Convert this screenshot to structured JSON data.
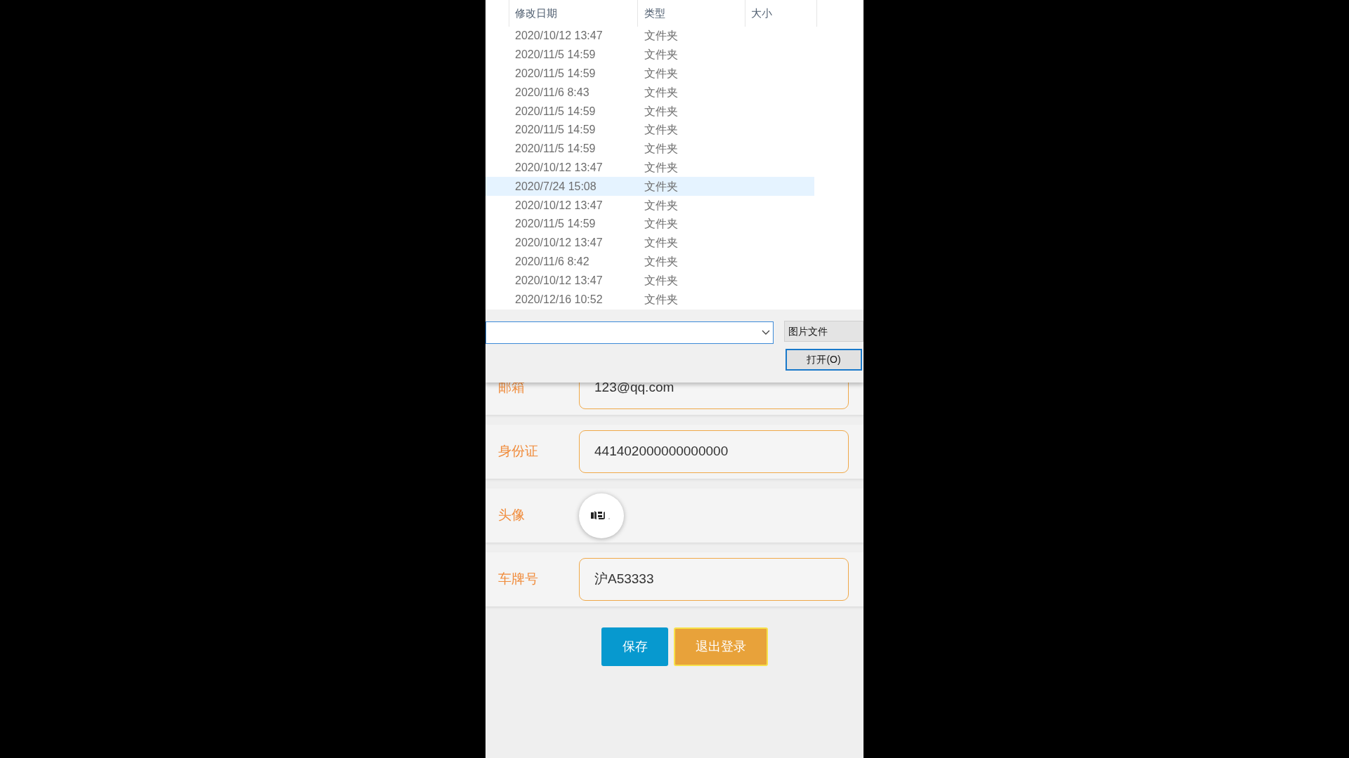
{
  "file_dialog": {
    "columns": [
      {
        "label": "修改日期"
      },
      {
        "label": "类型"
      },
      {
        "label": "大小"
      }
    ],
    "rows": [
      {
        "modified": "2020/10/12 13:47",
        "type": "文件夹",
        "selected": false
      },
      {
        "modified": "2020/11/5 14:59",
        "type": "文件夹",
        "selected": false
      },
      {
        "modified": "2020/11/5 14:59",
        "type": "文件夹",
        "selected": false
      },
      {
        "modified": "2020/11/6 8:43",
        "type": "文件夹",
        "selected": false
      },
      {
        "modified": "2020/11/5 14:59",
        "type": "文件夹",
        "selected": false
      },
      {
        "modified": "2020/11/5 14:59",
        "type": "文件夹",
        "selected": false
      },
      {
        "modified": "2020/11/5 14:59",
        "type": "文件夹",
        "selected": false
      },
      {
        "modified": "2020/10/12 13:47",
        "type": "文件夹",
        "selected": false
      },
      {
        "modified": "2020/7/24 15:08",
        "type": "文件夹",
        "selected": true
      },
      {
        "modified": "2020/10/12 13:47",
        "type": "文件夹",
        "selected": false
      },
      {
        "modified": "2020/11/5 14:59",
        "type": "文件夹",
        "selected": false
      },
      {
        "modified": "2020/10/12 13:47",
        "type": "文件夹",
        "selected": false
      },
      {
        "modified": "2020/11/6 8:42",
        "type": "文件夹",
        "selected": false
      },
      {
        "modified": "2020/10/12 13:47",
        "type": "文件夹",
        "selected": false
      },
      {
        "modified": "2020/12/16 10:52",
        "type": "文件夹",
        "selected": false
      }
    ],
    "file_type_filter": "图片文件",
    "open_button": "打开(O)"
  },
  "form": {
    "fields": [
      {
        "kind": "input",
        "label": "邮箱",
        "value": "123@qq.com"
      },
      {
        "kind": "input",
        "label": "身份证",
        "value": "441402000000000000"
      },
      {
        "kind": "avatar",
        "label": "头像"
      },
      {
        "kind": "input",
        "label": "车牌号",
        "value": "沪A53333"
      }
    ],
    "buttons": [
      {
        "kind": "primary",
        "label": "保存"
      },
      {
        "kind": "warning",
        "label": "退出登录"
      }
    ]
  }
}
